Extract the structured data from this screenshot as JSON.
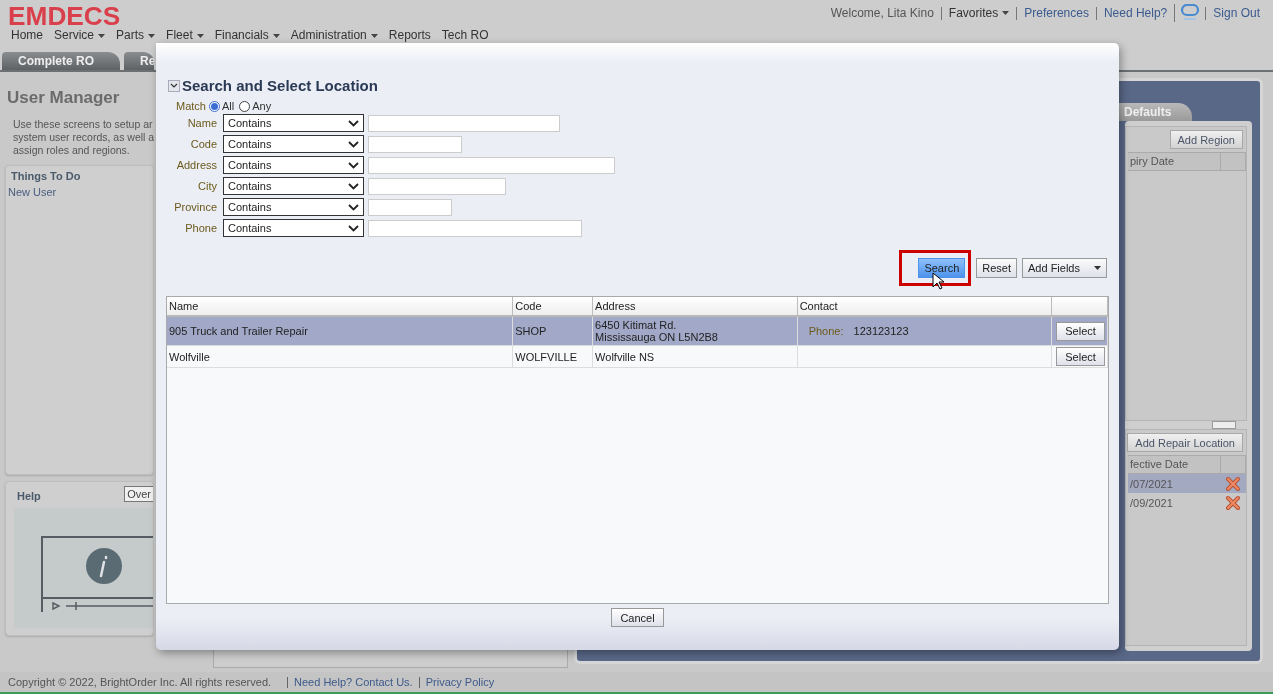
{
  "header": {
    "logo": "EMDECS",
    "user_links": [
      {
        "kind": "text",
        "label": "Welcome, Lita Kino"
      },
      {
        "kind": "menu",
        "label": "Favorites"
      },
      {
        "kind": "link",
        "label": "Preferences"
      },
      {
        "kind": "link",
        "label": "Need Help?"
      },
      {
        "kind": "icon"
      },
      {
        "kind": "link",
        "label": "Sign Out"
      }
    ]
  },
  "nav": [
    {
      "label": "Home",
      "has_menu": false
    },
    {
      "label": "Service",
      "has_menu": true
    },
    {
      "label": "Parts",
      "has_menu": true
    },
    {
      "label": "Fleet",
      "has_menu": true
    },
    {
      "label": "Financials",
      "has_menu": true
    },
    {
      "label": "Administration",
      "has_menu": true
    },
    {
      "label": "Reports",
      "has_menu": false
    },
    {
      "label": "Tech RO",
      "has_menu": false
    }
  ],
  "tabs": [
    {
      "label": "Complete RO",
      "selected": false
    },
    {
      "label": "Re",
      "selected": false
    }
  ],
  "left_panel": {
    "title": "User Manager",
    "description": [
      "Use these screens to setup ar",
      "system user records, as well a",
      "assign roles and regions."
    ],
    "things_to_do": {
      "title": "Things To Do",
      "items": [
        "New User"
      ]
    },
    "help": {
      "title": "Help",
      "button": "Over"
    }
  },
  "right_panel": {
    "tab": "Defaults",
    "regions": {
      "button": "Add Region",
      "columns": [
        "piry Date"
      ]
    },
    "repair_locations": {
      "button": "Add Repair Location",
      "columns": [
        "fective Date"
      ],
      "rows": [
        {
          "date": "/07/2021",
          "selected": true
        },
        {
          "date": "/09/2021",
          "selected": false
        }
      ]
    }
  },
  "dialog": {
    "title": "Search and Select Location",
    "expanded": true,
    "match": {
      "label": "Match",
      "options": [
        {
          "label": "All",
          "selected": true
        },
        {
          "label": "Any",
          "selected": false
        }
      ]
    },
    "criteria": [
      {
        "label": "Name",
        "operator": "Contains"
      },
      {
        "label": "Code",
        "operator": "Contains"
      },
      {
        "label": "Address",
        "operator": "Contains"
      },
      {
        "label": "City",
        "operator": "Contains"
      },
      {
        "label": "Province",
        "operator": "Contains"
      },
      {
        "label": "Phone",
        "operator": "Contains"
      }
    ],
    "buttons": [
      {
        "kind": "primary",
        "label": "Search",
        "highlighted": true
      },
      {
        "kind": "plain",
        "label": "Reset",
        "highlighted": false
      },
      {
        "kind": "menu",
        "label": "Add Fields",
        "highlighted": false
      }
    ],
    "table": {
      "columns": [
        "Name",
        "Code",
        "Address",
        "Contact"
      ],
      "rows": [
        {
          "name": "905 Truck and Trailer Repair",
          "code": "SHOP",
          "address": "6450 Kitimat Rd.\nMississauga ON L5N2B8",
          "contact_label": "Phone:",
          "contact": "123123123",
          "action": "Select",
          "selected": true
        },
        {
          "name": "Wolfville",
          "code": "WOLFVILLE",
          "address": "Wolfville NS",
          "action": "Select",
          "selected": false
        }
      ]
    },
    "cancel": "Cancel"
  },
  "footer": {
    "copyright": "Copyright © 2022, BrightOrder Inc. All rights reserved.",
    "links": [
      "Need Help? Contact Us.",
      "Privacy Policy"
    ]
  }
}
